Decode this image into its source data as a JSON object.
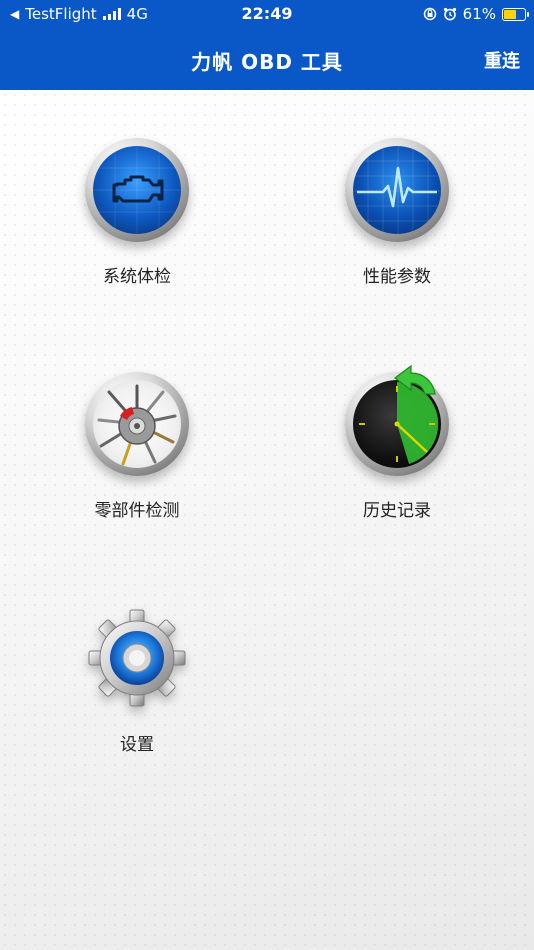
{
  "status_bar": {
    "back_arrow": "◀",
    "back_app": "TestFlight",
    "network": "4G",
    "time": "22:49",
    "battery_percent": "61%",
    "battery_level": 0.61
  },
  "nav": {
    "title": "力帆 OBD 工具",
    "right_button": "重连"
  },
  "menu": {
    "items": [
      {
        "label": "系统体检",
        "icon": "engine-icon"
      },
      {
        "label": "性能参数",
        "icon": "pulse-icon"
      },
      {
        "label": "零部件检测",
        "icon": "parts-icon"
      },
      {
        "label": "历史记录",
        "icon": "history-clock-icon"
      },
      {
        "label": "设置",
        "icon": "gear-icon"
      }
    ]
  },
  "colors": {
    "header": "#0a58c8",
    "icon_blue": "#1e7fe0",
    "history_green": "#2fb52f",
    "battery": "#ffd400"
  }
}
